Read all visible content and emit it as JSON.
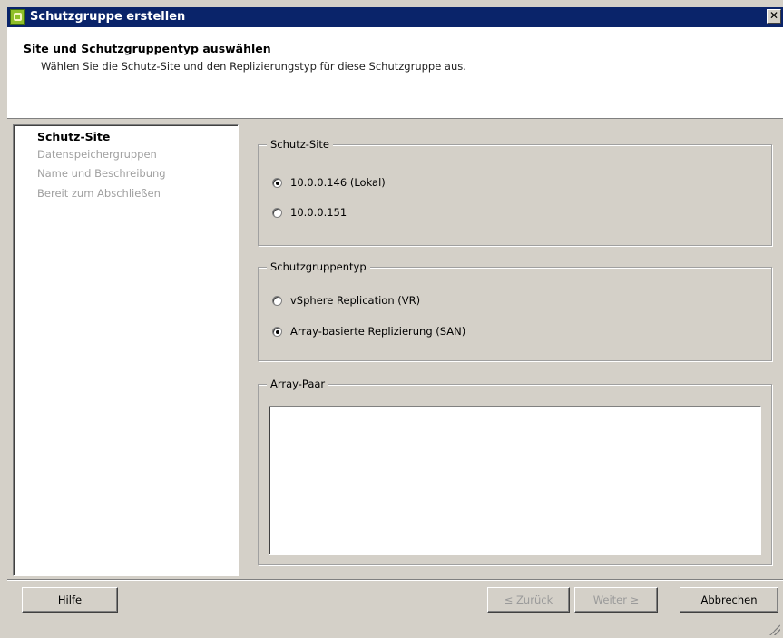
{
  "window": {
    "title": "Schutzgruppe erstellen",
    "close_glyph": "✕",
    "app_icon": "vsphere-app-icon"
  },
  "header": {
    "title": "Site und Schutzgruppentyp auswählen",
    "subtitle": "Wählen Sie die Schutz-Site und den Replizierungstyp für diese Schutzgruppe aus."
  },
  "steps": [
    {
      "label": "Schutz-Site",
      "active": true
    },
    {
      "label": "Datenspeichergruppen",
      "active": false
    },
    {
      "label": "Name und Beschreibung",
      "active": false
    },
    {
      "label": "Bereit zum Abschließen",
      "active": false
    }
  ],
  "protection_site": {
    "legend": "Schutz-Site",
    "options": [
      {
        "label": "10.0.0.146 (Lokal)",
        "selected": true
      },
      {
        "label": "10.0.0.151",
        "selected": false
      }
    ]
  },
  "group_type": {
    "legend": "Schutzgruppentyp",
    "options": [
      {
        "label": "vSphere Replication (VR)",
        "selected": false
      },
      {
        "label": "Array-basierte Replizierung (SAN)",
        "selected": true
      }
    ]
  },
  "array_pair": {
    "legend": "Array-Paar",
    "items": []
  },
  "buttons": {
    "help": "Hilfe",
    "back": "≤ Zurück",
    "next": "Weiter ≥",
    "cancel": "Abbrechen"
  }
}
